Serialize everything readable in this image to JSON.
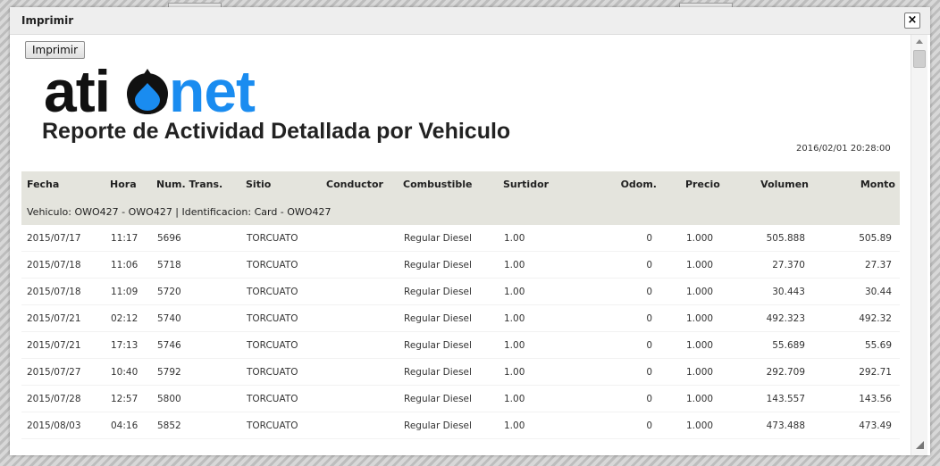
{
  "dialog": {
    "title": "Imprimir",
    "close_icon": "×"
  },
  "toolbar": {
    "print_label": "Imprimir"
  },
  "logo": {
    "text_left": "ati",
    "text_right": "net",
    "drop_color": "#1a8cf0",
    "left_color": "#111111"
  },
  "report": {
    "title": "Reporte de Actividad Detallada por Vehiculo",
    "generated": "2016/02/01 20:28:00"
  },
  "table": {
    "headers": {
      "fecha": "Fecha",
      "hora": "Hora",
      "num": "Num. Trans.",
      "sitio": "Sitio",
      "conductor": "Conductor",
      "combustible": "Combustible",
      "surtidor": "Surtidor",
      "odom": "Odom.",
      "precio": "Precio",
      "volumen": "Volumen",
      "monto": "Monto"
    },
    "group": "Vehiculo: OWO427 - OWO427 | Identificacion: Card - OWO427",
    "rows": [
      {
        "fecha": "2015/07/17",
        "hora": "11:17",
        "num": "5696",
        "sitio": "TORCUATO",
        "conductor": "",
        "combustible": "Regular Diesel",
        "surtidor": "1.00",
        "odom": "0",
        "precio": "1.000",
        "volumen": "505.888",
        "monto": "505.89"
      },
      {
        "fecha": "2015/07/18",
        "hora": "11:06",
        "num": "5718",
        "sitio": "TORCUATO",
        "conductor": "",
        "combustible": "Regular Diesel",
        "surtidor": "1.00",
        "odom": "0",
        "precio": "1.000",
        "volumen": "27.370",
        "monto": "27.37"
      },
      {
        "fecha": "2015/07/18",
        "hora": "11:09",
        "num": "5720",
        "sitio": "TORCUATO",
        "conductor": "",
        "combustible": "Regular Diesel",
        "surtidor": "1.00",
        "odom": "0",
        "precio": "1.000",
        "volumen": "30.443",
        "monto": "30.44"
      },
      {
        "fecha": "2015/07/21",
        "hora": "02:12",
        "num": "5740",
        "sitio": "TORCUATO",
        "conductor": "",
        "combustible": "Regular Diesel",
        "surtidor": "1.00",
        "odom": "0",
        "precio": "1.000",
        "volumen": "492.323",
        "monto": "492.32"
      },
      {
        "fecha": "2015/07/21",
        "hora": "17:13",
        "num": "5746",
        "sitio": "TORCUATO",
        "conductor": "",
        "combustible": "Regular Diesel",
        "surtidor": "1.00",
        "odom": "0",
        "precio": "1.000",
        "volumen": "55.689",
        "monto": "55.69"
      },
      {
        "fecha": "2015/07/27",
        "hora": "10:40",
        "num": "5792",
        "sitio": "TORCUATO",
        "conductor": "",
        "combustible": "Regular Diesel",
        "surtidor": "1.00",
        "odom": "0",
        "precio": "1.000",
        "volumen": "292.709",
        "monto": "292.71"
      },
      {
        "fecha": "2015/07/28",
        "hora": "12:57",
        "num": "5800",
        "sitio": "TORCUATO",
        "conductor": "",
        "combustible": "Regular Diesel",
        "surtidor": "1.00",
        "odom": "0",
        "precio": "1.000",
        "volumen": "143.557",
        "monto": "143.56"
      },
      {
        "fecha": "2015/08/03",
        "hora": "04:16",
        "num": "5852",
        "sitio": "TORCUATO",
        "conductor": "",
        "combustible": "Regular Diesel",
        "surtidor": "1.00",
        "odom": "0",
        "precio": "1.000",
        "volumen": "473.488",
        "monto": "473.49"
      }
    ]
  },
  "scroll": {
    "up_icon": "scroll-up-icon",
    "position": 0.02
  }
}
